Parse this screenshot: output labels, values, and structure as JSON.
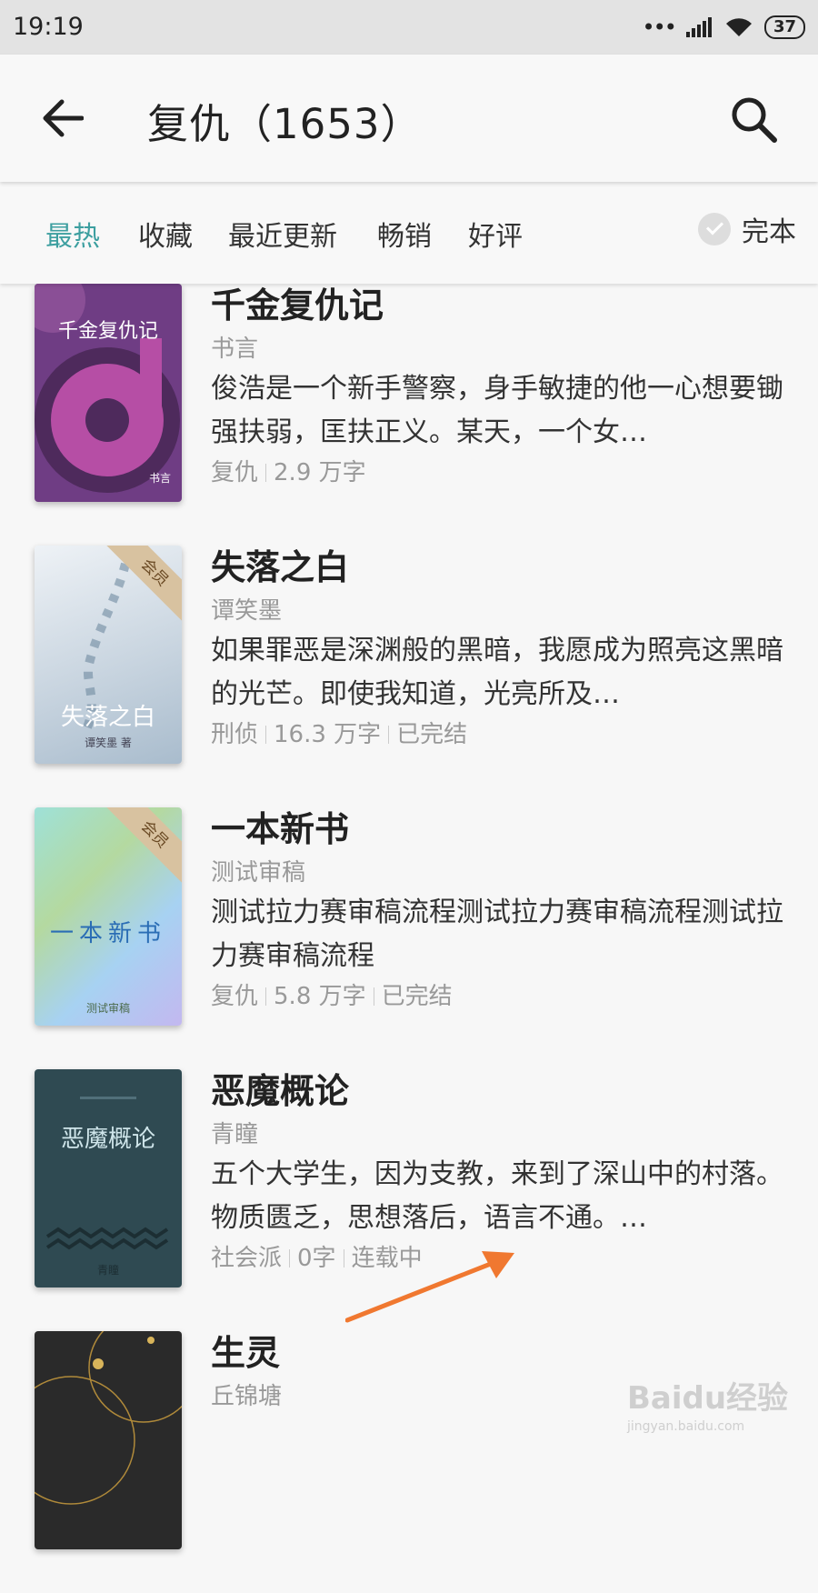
{
  "status": {
    "time": "19:19",
    "battery": "37"
  },
  "header": {
    "title": "复仇（1653）"
  },
  "tabs": [
    "最热",
    "收藏",
    "最近更新",
    "畅销",
    "好评"
  ],
  "complete_label": "完本",
  "books": [
    {
      "title": "千金复仇记",
      "author": "书言",
      "desc": "俊浩是一个新手警察，身手敏捷的他一心想要锄强扶弱，匡扶正义。某天，一个女…",
      "meta": [
        "复仇",
        "2.9 万字"
      ],
      "cover_title": "千金复仇记",
      "cover_sub": "书言"
    },
    {
      "title": "失落之白",
      "author": "谭笑墨",
      "desc": "如果罪恶是深渊般的黑暗，我愿成为照亮这黑暗的光芒。即使我知道，光亮所及…",
      "meta": [
        "刑侦",
        "16.3 万字",
        "已完结"
      ],
      "badge": "会员",
      "cover_title": "失落之白",
      "cover_sub": "谭笑墨 著"
    },
    {
      "title": "一本新书",
      "author": "测试审稿",
      "desc": "测试拉力赛审稿流程测试拉力赛审稿流程测试拉力赛审稿流程",
      "meta": [
        "复仇",
        "5.8 万字",
        "已完结"
      ],
      "badge": "会员",
      "cover_title": "一本新书",
      "cover_sub": "测试审稿"
    },
    {
      "title": "恶魔概论",
      "author": "青瞳",
      "desc": "五个大学生，因为支教，来到了深山中的村落。物质匮乏，思想落后，语言不通。…",
      "meta": [
        "社会派",
        "0字",
        "连载中"
      ],
      "cover_title": "恶魔概论",
      "cover_sub": "青瞳"
    },
    {
      "title": "生灵",
      "author": "丘锦塘",
      "desc": "",
      "meta": [],
      "cover_title": ""
    }
  ],
  "watermark": {
    "main": "Baidu经验",
    "sub": "jingyan.baidu.com"
  },
  "colors": {
    "accent": "#3d9fa0",
    "annotation_arrow": "#f07830"
  }
}
